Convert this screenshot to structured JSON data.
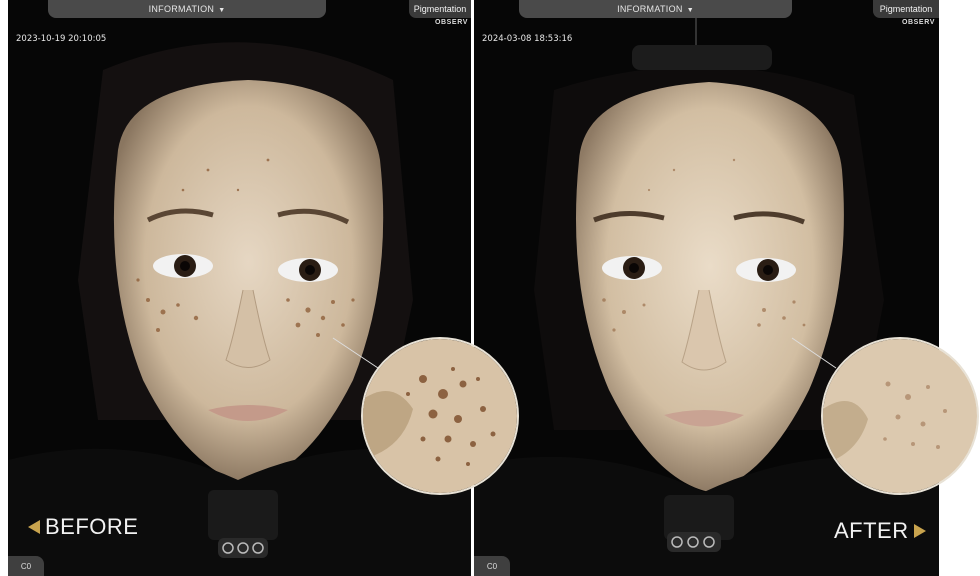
{
  "panels": {
    "before": {
      "info_label": "INFORMATION",
      "mode_label": "Pigmentation",
      "brand": "OBSERV",
      "timestamp": "2023-10-19 20:10:05",
      "corner_label": "C0",
      "caption": "BEFORE"
    },
    "after": {
      "info_label": "INFORMATION",
      "mode_label": "Pigmentation",
      "brand": "OBSERV",
      "timestamp": "2024-03-08 18:53:16",
      "corner_label": "C0",
      "caption": "AFTER"
    }
  },
  "icons": {
    "info_chevron": "chevron-down-icon",
    "before_arrow": "triangle-left-icon",
    "after_arrow": "triangle-right-icon"
  },
  "colors": {
    "accent_arrow": "#c9a44e",
    "background": "#050505",
    "skin": "#d9c6ad"
  }
}
